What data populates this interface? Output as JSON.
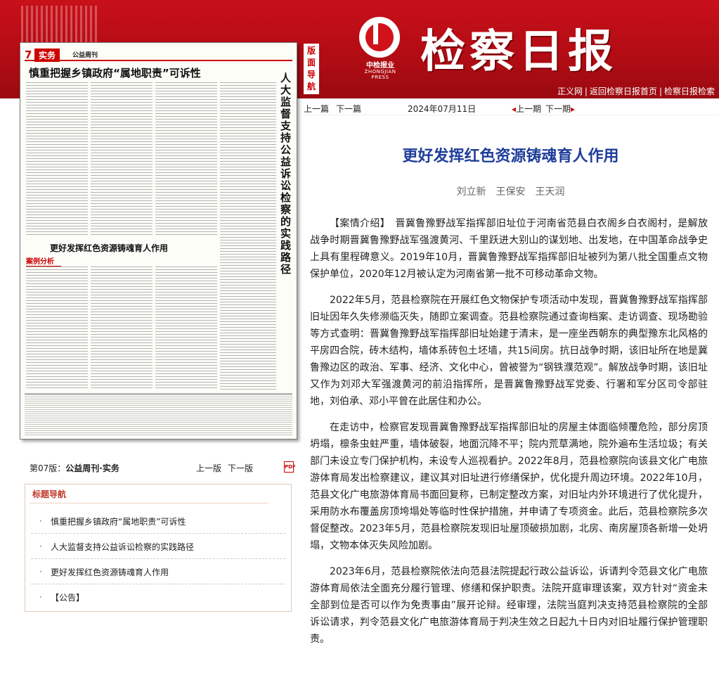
{
  "header": {
    "masthead": "检察日报",
    "press_cn": "中检报业",
    "press_en": "ZHONGJIAN PRESS",
    "nav_tag": "版面导航",
    "links": [
      "正义网",
      "返回检察日报首页",
      "检察日报检索"
    ]
  },
  "scan": {
    "page_num": "7",
    "section": "实务",
    "column": "公益周刊",
    "headline1": "慎重把握乡镇政府“属地职责”可诉性",
    "headline_vertical": "人大监督支持公益诉讼检察的实践路径",
    "headline2": "更好发挥红色资源铸魂育人作用",
    "case_label": "案例分析"
  },
  "page_nav": {
    "label": "第07版：",
    "page_name": "公益周刊·实务",
    "prev": "上一版",
    "next": "下一版",
    "pdf": "PDF"
  },
  "toc": {
    "heading": "标题导航",
    "items": [
      "慎重把握乡镇政府“属地职责”可诉性",
      "人大监督支持公益诉讼检察的实践路径",
      "更好发挥红色资源铸魂育人作用",
      "【公告】"
    ]
  },
  "article_bar": {
    "prev_article": "上一篇",
    "next_article": "下一篇",
    "date": "2024年07月11日",
    "prev_issue": "上一期",
    "next_issue": "下一期"
  },
  "article": {
    "title": "更好发挥红色资源铸魂育人作用",
    "authors": "刘立新　王保安　王天润",
    "paragraphs": [
      "【案情介绍】　晋冀鲁豫野战军指挥部旧址位于河南省范县白衣阁乡白衣阁村，是解放战争时期晋冀鲁豫野战军强渡黄河、千里跃进大别山的谋划地、出发地，在中国革命战争史上具有里程碑意义。2019年10月，晋冀鲁豫野战军指挥部旧址被列为第八批全国重点文物保护单位，2020年12月被认定为河南省第一批不可移动革命文物。",
      "2022年5月，范县检察院在开展红色文物保护专项活动中发现，晋冀鲁豫野战军指挥部旧址因年久失修濒临灭失，随即立案调查。范县检察院通过查询档案、走访调查、现场勘验等方式查明：晋冀鲁豫野战军指挥部旧址始建于清末，是一座坐西朝东的典型豫东北风格的平房四合院，砖木结构，墙体系砖包土坯墙，共15间房。抗日战争时期，该旧址所在地是冀鲁豫边区的政治、军事、经济、文化中心，曾被誉为“钢铁濮范观”。解放战争时期，该旧址又作为刘邓大军强渡黄河的前沿指挥所，是晋冀鲁豫野战军党委、行署和军分区司令部驻地，刘伯承、邓小平曾在此居住和办公。",
      "在走访中，检察官发现晋冀鲁豫野战军指挥部旧址的房屋主体面临倾覆危险，部分房顶坍塌，檩条虫蛀严重，墙体破裂，地面沉降不平；院内荒草满地，院外遍布生活垃圾；有关部门未设立专门保护机构，未设专人巡视看护。2022年8月，范县检察院向该县文化广电旅游体育局发出检察建议，建议其对旧址进行修缮保护，优化提升周边环境。2022年10月，范县文化广电旅游体育局书面回复称，已制定整改方案，对旧址内外环境进行了优化提升，采用防水布覆盖房顶垮塌处等临时性保护措施，并申请了专项资金。此后，范县检察院多次督促整改。2023年5月，范县检察院发现旧址屋顶破损加剧，北房、南房屋顶各新增一处坍塌，文物本体灭失风险加剧。",
      "2023年6月，范县检察院依法向范县法院提起行政公益诉讼，诉请判令范县文化广电旅游体育局依法全面充分履行管理、修缮和保护职责。法院开庭审理该案，双方针对“资金未全部到位是否可以作为免责事由”展开论辩。经审理，法院当庭判决支持范县检察院的全部诉讼请求，判令范县文化广电旅游体育局于判决生效之日起九十日内对旧址履行保护管理职责。"
    ]
  }
}
